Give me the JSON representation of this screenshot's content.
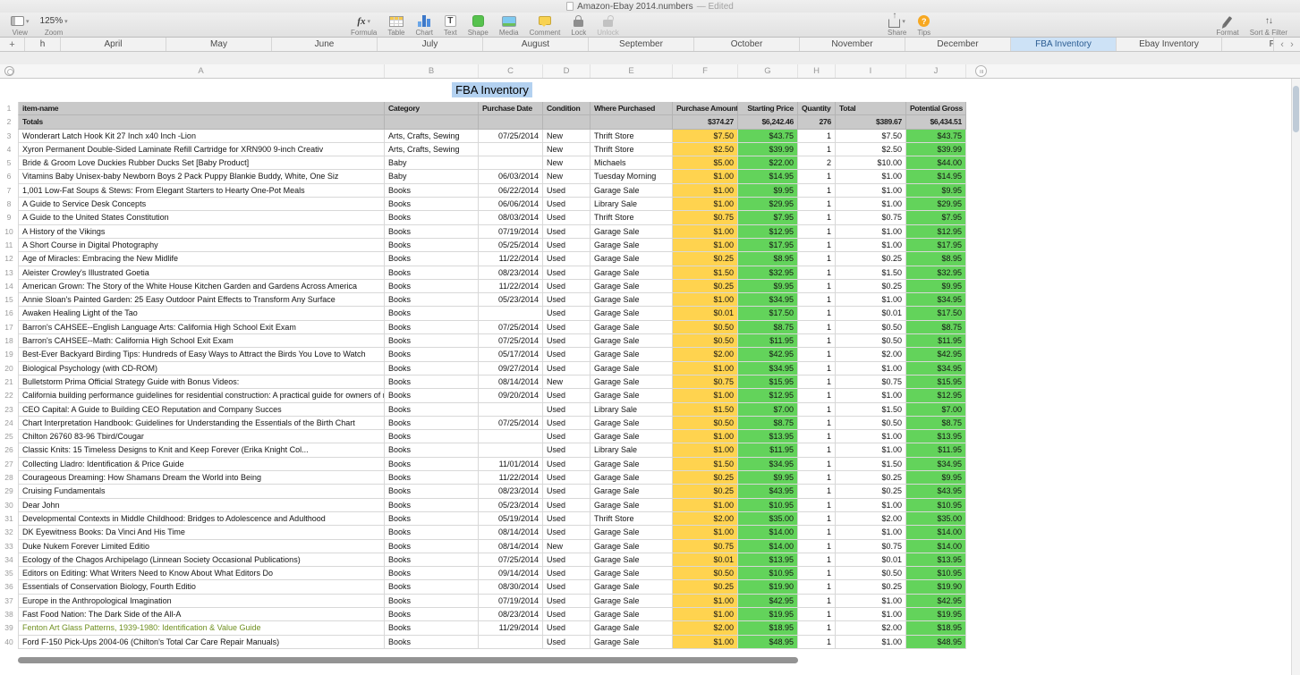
{
  "colors": {
    "purchase_amount_fill": "#FFD34F",
    "price_fill": "#63D35B",
    "header_fill": "#C9C9C9",
    "active_tab_fill": "#CDE2F6",
    "selection_fill": "#B3D1F0"
  },
  "titlebar": {
    "title": "Amazon-Ebay 2014.numbers",
    "edited": "— Edited"
  },
  "toolbar": {
    "view": {
      "label": "View"
    },
    "zoom": {
      "label": "Zoom",
      "value": "125%"
    },
    "formula": {
      "label": "Formula",
      "glyph": "fx"
    },
    "table": {
      "label": "Table"
    },
    "chart": {
      "label": "Chart"
    },
    "text": {
      "label": "Text",
      "glyph": "T"
    },
    "shape": {
      "label": "Shape"
    },
    "media": {
      "label": "Media"
    },
    "comment": {
      "label": "Comment"
    },
    "lock": {
      "label": "Lock"
    },
    "unlock": {
      "label": "Unlock"
    },
    "share": {
      "label": "Share"
    },
    "tips": {
      "label": "Tips",
      "glyph": "?"
    },
    "format": {
      "label": "Format"
    },
    "sort_filter": {
      "label": "Sort & Filter"
    }
  },
  "tabbar": {
    "add_label": "+",
    "tabs": [
      "h",
      "April",
      "May",
      "June",
      "July",
      "August",
      "September",
      "October",
      "November",
      "December",
      "FBA Inventory",
      "Ebay Inventory",
      "Fe"
    ],
    "active_index": 10,
    "scroll_left": "‹",
    "scroll_right": "›"
  },
  "sheet": {
    "table_title": "FBA Inventory",
    "column_letters": [
      "A",
      "B",
      "C",
      "D",
      "E",
      "F",
      "G",
      "H",
      "I",
      "J"
    ],
    "headers": [
      "item-name",
      "Category",
      "Purchase Date",
      "Condition",
      "Where Purchased",
      "Purchase Amount",
      "Starting Price",
      "Quantity",
      "Total",
      "Potential Gross"
    ],
    "totals_row": [
      "Totals",
      "",
      "",
      "",
      "",
      "$374.27",
      "$6,242.46",
      "276",
      "$389.67",
      "$6,434.51"
    ],
    "green_text_row_index": 36,
    "rows": [
      [
        "Wonderart Latch Hook Kit 27 Inch x40 Inch -Lion",
        "Arts, Crafts, Sewing",
        "07/25/2014",
        "New",
        "Thrift Store",
        "$7.50",
        "$43.75",
        "1",
        "$7.50",
        "$43.75"
      ],
      [
        "Xyron Permanent Double-Sided Laminate Refill Cartridge for XRN900 9-inch Creativ",
        "Arts, Crafts, Sewing",
        "",
        "New",
        "Thrift Store",
        "$2.50",
        "$39.99",
        "1",
        "$2.50",
        "$39.99"
      ],
      [
        "Bride & Groom Love Duckies Rubber Ducks Set [Baby Product]",
        "Baby",
        "",
        "New",
        "Michaels",
        "$5.00",
        "$22.00",
        "2",
        "$10.00",
        "$44.00"
      ],
      [
        "Vitamins Baby Unisex-baby Newborn Boys 2 Pack Puppy Blankie Buddy, White, One Siz",
        "Baby",
        "06/03/2014",
        "New",
        "Tuesday Morning",
        "$1.00",
        "$14.95",
        "1",
        "$1.00",
        "$14.95"
      ],
      [
        "1,001 Low-Fat Soups & Stews: From Elegant Starters to Hearty One-Pot Meals",
        "Books",
        "06/22/2014",
        "Used",
        "Garage Sale",
        "$1.00",
        "$9.95",
        "1",
        "$1.00",
        "$9.95"
      ],
      [
        "A Guide to Service Desk Concepts",
        "Books",
        "06/06/2014",
        "Used",
        "Library Sale",
        "$1.00",
        "$29.95",
        "1",
        "$1.00",
        "$29.95"
      ],
      [
        "A Guide to the United States Constitution",
        "Books",
        "08/03/2014",
        "Used",
        "Thrift Store",
        "$0.75",
        "$7.95",
        "1",
        "$0.75",
        "$7.95"
      ],
      [
        "A History of the Vikings",
        "Books",
        "07/19/2014",
        "Used",
        "Garage Sale",
        "$1.00",
        "$12.95",
        "1",
        "$1.00",
        "$12.95"
      ],
      [
        "A Short Course in Digital Photography",
        "Books",
        "05/25/2014",
        "Used",
        "Garage Sale",
        "$1.00",
        "$17.95",
        "1",
        "$1.00",
        "$17.95"
      ],
      [
        "Age of Miracles: Embracing the New Midlife",
        "Books",
        "11/22/2014",
        "Used",
        "Garage Sale",
        "$0.25",
        "$8.95",
        "1",
        "$0.25",
        "$8.95"
      ],
      [
        "Aleister Crowley's Illustrated Goetia",
        "Books",
        "08/23/2014",
        "Used",
        "Garage Sale",
        "$1.50",
        "$32.95",
        "1",
        "$1.50",
        "$32.95"
      ],
      [
        "American Grown: The Story of the White House Kitchen Garden and Gardens Across America",
        "Books",
        "11/22/2014",
        "Used",
        "Garage Sale",
        "$0.25",
        "$9.95",
        "1",
        "$0.25",
        "$9.95"
      ],
      [
        "Annie Sloan's Painted Garden: 25 Easy Outdoor Paint Effects to Transform Any Surface",
        "Books",
        "05/23/2014",
        "Used",
        "Garage Sale",
        "$1.00",
        "$34.95",
        "1",
        "$1.00",
        "$34.95"
      ],
      [
        "Awaken Healing Light of the Tao",
        "Books",
        "",
        "Used",
        "Garage Sale",
        "$0.01",
        "$17.50",
        "1",
        "$0.01",
        "$17.50"
      ],
      [
        "Barron's CAHSEE--English Language Arts: California High School Exit Exam",
        "Books",
        "07/25/2014",
        "Used",
        "Garage Sale",
        "$0.50",
        "$8.75",
        "1",
        "$0.50",
        "$8.75"
      ],
      [
        "Barron's CAHSEE--Math: California High School Exit Exam",
        "Books",
        "07/25/2014",
        "Used",
        "Garage Sale",
        "$0.50",
        "$11.95",
        "1",
        "$0.50",
        "$11.95"
      ],
      [
        "Best-Ever Backyard Birding Tips: Hundreds of Easy Ways to Attract the Birds You Love to Watch",
        "Books",
        "05/17/2014",
        "Used",
        "Garage Sale",
        "$2.00",
        "$42.95",
        "1",
        "$2.00",
        "$42.95"
      ],
      [
        "Biological Psychology (with CD-ROM)",
        "Books",
        "09/27/2014",
        "Used",
        "Garage Sale",
        "$1.00",
        "$34.95",
        "1",
        "$1.00",
        "$34.95"
      ],
      [
        "Bulletstorm Prima Official Strategy Guide with Bonus Videos:",
        "Books",
        "08/14/2014",
        "New",
        "Garage Sale",
        "$0.75",
        "$15.95",
        "1",
        "$0.75",
        "$15.95"
      ],
      [
        "California building performance guidelines for residential construction: A practical guide for owners of new homes : constr",
        "Books",
        "09/20/2014",
        "Used",
        "Garage Sale",
        "$1.00",
        "$12.95",
        "1",
        "$1.00",
        "$12.95"
      ],
      [
        "CEO Capital: A Guide to Building CEO Reputation and Company Succes",
        "Books",
        "",
        "Used",
        "Library Sale",
        "$1.50",
        "$7.00",
        "1",
        "$1.50",
        "$7.00"
      ],
      [
        "Chart Interpretation Handbook: Guidelines for Understanding the Essentials of the Birth Chart",
        "Books",
        "07/25/2014",
        "Used",
        "Garage Sale",
        "$0.50",
        "$8.75",
        "1",
        "$0.50",
        "$8.75"
      ],
      [
        "Chilton 26760 83-96 Tbird/Cougar",
        "Books",
        "",
        "Used",
        "Garage Sale",
        "$1.00",
        "$13.95",
        "1",
        "$1.00",
        "$13.95"
      ],
      [
        "Classic Knits: 15 Timeless Designs to Knit and Keep Forever (Erika Knight Col...",
        "Books",
        "",
        "Used",
        "Library Sale",
        "$1.00",
        "$11.95",
        "1",
        "$1.00",
        "$11.95"
      ],
      [
        "Collecting Lladro: Identification & Price Guide",
        "Books",
        "11/01/2014",
        "Used",
        "Garage Sale",
        "$1.50",
        "$34.95",
        "1",
        "$1.50",
        "$34.95"
      ],
      [
        "Courageous Dreaming: How Shamans Dream the World into Being",
        "Books",
        "11/22/2014",
        "Used",
        "Garage Sale",
        "$0.25",
        "$9.95",
        "1",
        "$0.25",
        "$9.95"
      ],
      [
        "Cruising Fundamentals",
        "Books",
        "08/23/2014",
        "Used",
        "Garage Sale",
        "$0.25",
        "$43.95",
        "1",
        "$0.25",
        "$43.95"
      ],
      [
        "Dear John",
        "Books",
        "05/23/2014",
        "Used",
        "Garage Sale",
        "$1.00",
        "$10.95",
        "1",
        "$1.00",
        "$10.95"
      ],
      [
        "Developmental Contexts in Middle Childhood: Bridges to Adolescence and Adulthood",
        "Books",
        "05/19/2014",
        "Used",
        "Thrift Store",
        "$2.00",
        "$35.00",
        "1",
        "$2.00",
        "$35.00"
      ],
      [
        "DK Eyewitness Books: Da Vinci And His Time",
        "Books",
        "08/14/2014",
        "Used",
        "Garage Sale",
        "$1.00",
        "$14.00",
        "1",
        "$1.00",
        "$14.00"
      ],
      [
        "Duke Nukem Forever Limited Editio",
        "Books",
        "08/14/2014",
        "New",
        "Garage Sale",
        "$0.75",
        "$14.00",
        "1",
        "$0.75",
        "$14.00"
      ],
      [
        "Ecology of the Chagos Archipelago (Linnean Society Occasional Publications)",
        "Books",
        "07/25/2014",
        "Used",
        "Garage Sale",
        "$0.01",
        "$13.95",
        "1",
        "$0.01",
        "$13.95"
      ],
      [
        "Editors on Editing: What Writers Need to Know About What Editors Do",
        "Books",
        "09/14/2014",
        "Used",
        "Garage Sale",
        "$0.50",
        "$10.95",
        "1",
        "$0.50",
        "$10.95"
      ],
      [
        "Essentials of Conservation Biology, Fourth Editio",
        "Books",
        "08/30/2014",
        "Used",
        "Garage Sale",
        "$0.25",
        "$19.90",
        "1",
        "$0.25",
        "$19.90"
      ],
      [
        "Europe in the Anthropological Imagination",
        "Books",
        "07/19/2014",
        "Used",
        "Garage Sale",
        "$1.00",
        "$42.95",
        "1",
        "$1.00",
        "$42.95"
      ],
      [
        "Fast Food Nation: The Dark Side of the All-A",
        "Books",
        "08/23/2014",
        "Used",
        "Garage Sale",
        "$1.00",
        "$19.95",
        "1",
        "$1.00",
        "$19.95"
      ],
      [
        "Fenton Art Glass Patterns, 1939-1980: Identification & Value Guide",
        "Books",
        "11/29/2014",
        "Used",
        "Garage Sale",
        "$2.00",
        "$18.95",
        "1",
        "$2.00",
        "$18.95"
      ],
      [
        "Ford F-150 Pick-Ups 2004-06 (Chilton's Total Car Care Repair Manuals)",
        "Books",
        "",
        "Used",
        "Garage Sale",
        "$1.00",
        "$48.95",
        "1",
        "$1.00",
        "$48.95"
      ]
    ]
  }
}
